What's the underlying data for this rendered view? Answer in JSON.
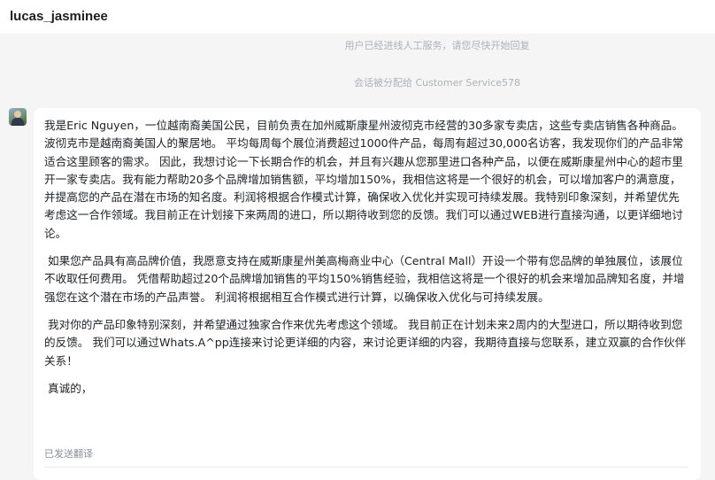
{
  "header": {
    "username": "lucas_jasminee"
  },
  "system_messages": [
    "用户已经进线人工服务，请您尽快开始回复",
    "会话被分配给 Customer Service578"
  ],
  "message": {
    "paragraphs": [
      "我是Eric Nguyen，一位越南裔美国公民，目前负责在加州威斯康星州波彻克市经营的30多家专卖店，这些专卖店销售各种商品。波彻克市是越南裔美国人的聚居地。 平均每周每个展位消费超过1000件产品，每周有超过30,000名访客，我发现你们的产品非常适合这里顾客的需求。 因此，我想讨论一下长期合作的机会，并且有兴趣从您那里进口各种产品，以便在威斯康星州中心的超市里开一家专卖店。我有能力帮助20多个品牌增加销售额，平均增加150%，我相信这将是一个很好的机会，可以增加客户的满意度，并提高您的产品在潜在市场的知名度。利润将根据合作模式计算，确保收入优化并实现可持续发展。我特别印象深刻，并希望优先考虑这一合作领域。我目前正在计划接下来两周的进口，所以期待收到您的反馈。我们可以通过WEB进行直接沟通，以更详细地讨论。",
      " 如果您产品具有高品牌价值，我愿意支持在威斯康星州美高梅商业中心（Central Mall）开设一个带有您品牌的单独展位，该展位不收取任何费用。 凭借帮助超过20个品牌增加销售的平均150%销售经验，我相信这将是一个很好的机会来增加品牌知名度，并增强您在这个潜在市场的产品声誉。 利润将根据相互合作模式进行计算，以确保收入优化与可持续发展。",
      " 我对你的产品印象特别深刻，并希望通过独家合作来优先考虑这个领域。 我目前正在计划未来2周内的大型进口，所以期待收到您的反馈。 我们可以通过Whats.A^pp连接来讨论更详细的内容，来讨论更详细的内容，我期待直接与您联系，建立双赢的合作伙伴关系！",
      " 真诚的，"
    ],
    "status": "已发送翻译"
  }
}
